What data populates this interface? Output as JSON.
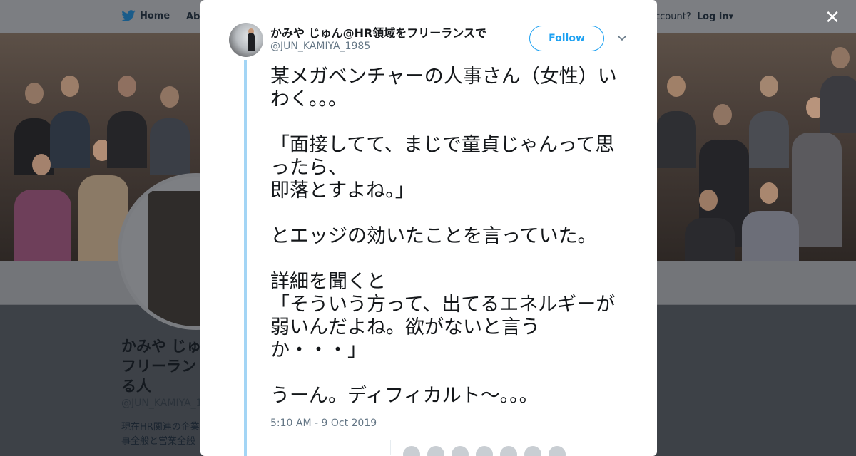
{
  "nav": {
    "home_label": "Home",
    "about_label": "Abo",
    "account_text": "ccount?",
    "login_label": "Log in"
  },
  "profile": {
    "name": "かみや じゅ\nフリーラン\nる人",
    "handle": "@JUN_KAMIYA_1",
    "bio": "現在HR関連の企業\n事全般と営業全般"
  },
  "modal": {
    "close_icon": "close-icon",
    "author_name": "かみや じゅん@HR領域をフリーランスで",
    "author_handle": "@JUN_KAMIYA_1985",
    "follow_label": "Follow",
    "tweet_text": "某メガベンチャーの人事さん（女性）いわく。。。\n\n「面接してて、まじで童貞じゃんって思ったら、\n即落とすよね。」\n\nとエッジの効いたことを言っていた。\n\n詳細を聞くと\n「そういう方って、出てるエネルギーが弱いんだよね。欲がないと言うか・・・」\n\nうーん。ディフィカルト～。。。",
    "timestamp": "5:10 AM - 9 Oct 2019"
  },
  "colors": {
    "accent": "#1da1f2",
    "thread_line": "#a3d5f5",
    "muted_text": "#657786",
    "overlay": "#3d4147"
  }
}
